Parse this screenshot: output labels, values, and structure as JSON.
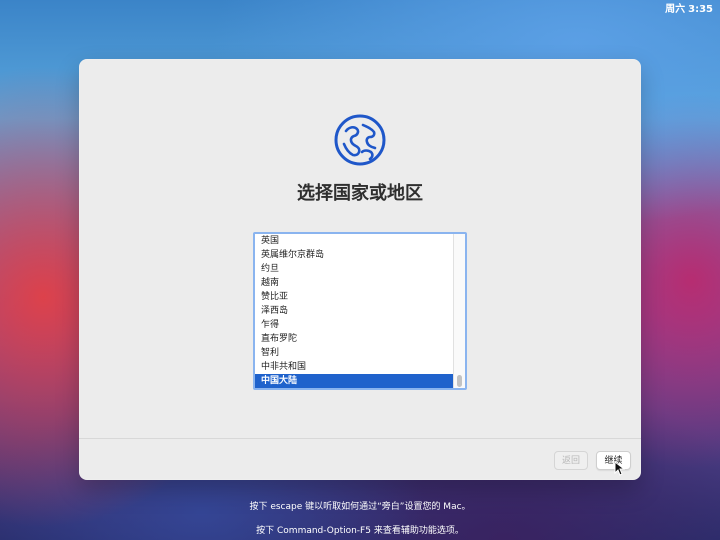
{
  "menu_bar": {
    "day": "周六",
    "time": "3:35"
  },
  "dialog": {
    "icon": "globe-icon",
    "title": "选择国家或地区",
    "countries": [
      "英国",
      "英属维尔京群岛",
      "约旦",
      "越南",
      "赞比亚",
      "泽西岛",
      "乍得",
      "直布罗陀",
      "智利",
      "中非共和国",
      "中国大陆"
    ],
    "selected_country": "中国大陆",
    "buttons": {
      "back": "返回",
      "continue": "继续"
    }
  },
  "footer": {
    "line1": "按下 escape 键以听取如何通过“旁白”设置您的 Mac。",
    "line2": "按下 Command-Option-F5 来查看辅助功能选项。"
  },
  "colors": {
    "selection": "#1f62cc",
    "listbox_focus": "#8ab4ef",
    "icon_blue": "#1f57c9",
    "window_background": "#ececec"
  },
  "icons": {
    "cursor": "pointer-cursor-icon"
  }
}
